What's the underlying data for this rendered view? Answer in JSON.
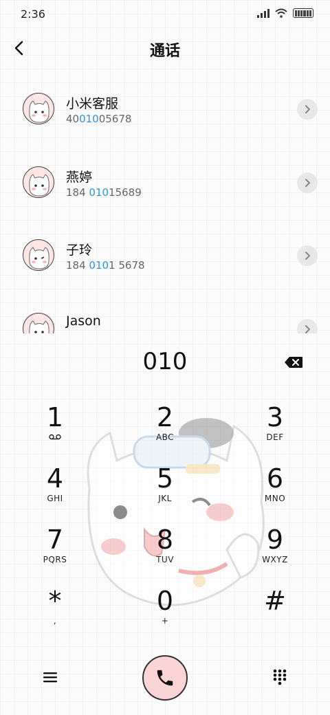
{
  "status_bar": {
    "time": "2:36"
  },
  "header": {
    "title": "通话"
  },
  "contacts": [
    {
      "name": "小米客服",
      "number_prefix": "40",
      "number_match": "010",
      "number_suffix": "05678"
    },
    {
      "name": "燕婷",
      "number_prefix": "184 ",
      "number_match": "010",
      "number_suffix": "15689"
    },
    {
      "name": "子玲",
      "number_prefix": "184 ",
      "number_match": "010",
      "number_suffix": "1 5678"
    },
    {
      "name": "Jason",
      "number_prefix": "",
      "number_match": "",
      "number_suffix": ""
    }
  ],
  "dialer": {
    "input": "010"
  },
  "keypad": [
    {
      "digit": "1",
      "letters": ""
    },
    {
      "digit": "2",
      "letters": "ABC"
    },
    {
      "digit": "3",
      "letters": "DEF"
    },
    {
      "digit": "4",
      "letters": "GHI"
    },
    {
      "digit": "5",
      "letters": "JKL"
    },
    {
      "digit": "6",
      "letters": "MNO"
    },
    {
      "digit": "7",
      "letters": "PQRS"
    },
    {
      "digit": "8",
      "letters": "TUV"
    },
    {
      "digit": "9",
      "letters": "WXYZ"
    },
    {
      "digit": "*",
      "letters": ","
    },
    {
      "digit": "0",
      "letters": "+"
    },
    {
      "digit": "#",
      "letters": ""
    }
  ],
  "colors": {
    "highlight": "#2a97d8",
    "call_button": "#fbd4d4"
  },
  "icons": [
    "back-arrow-icon",
    "chevron-right-icon",
    "backspace-icon",
    "voicemail-icon",
    "menu-icon",
    "phone-icon",
    "dialpad-icon"
  ]
}
